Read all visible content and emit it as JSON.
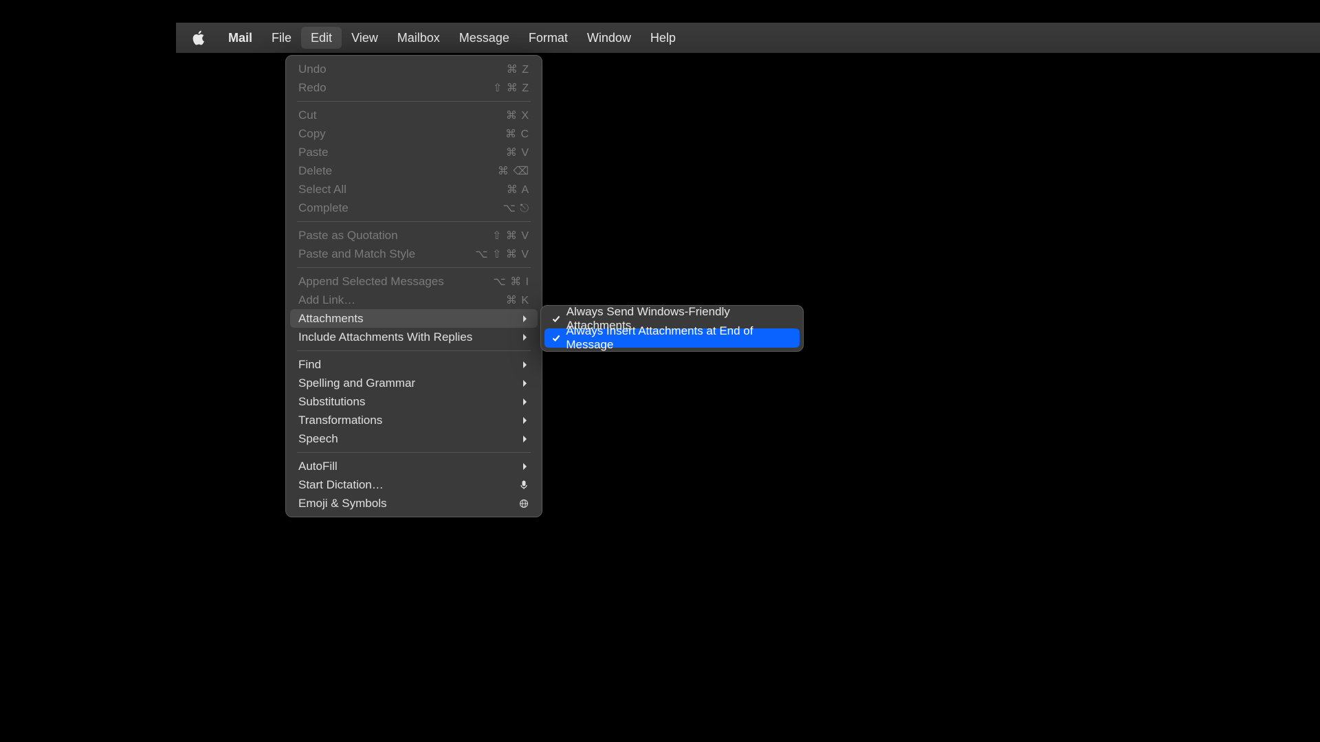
{
  "menubar": {
    "app": "Mail",
    "items": [
      "File",
      "Edit",
      "View",
      "Mailbox",
      "Message",
      "Format",
      "Window",
      "Help"
    ],
    "open_index": 1
  },
  "edit_menu": {
    "groups": [
      [
        {
          "label": "Undo",
          "shortcut": "⌘ Z",
          "disabled": true
        },
        {
          "label": "Redo",
          "shortcut": "⇧ ⌘ Z",
          "disabled": true
        }
      ],
      [
        {
          "label": "Cut",
          "shortcut": "⌘ X",
          "disabled": true
        },
        {
          "label": "Copy",
          "shortcut": "⌘ C",
          "disabled": true
        },
        {
          "label": "Paste",
          "shortcut": "⌘ V",
          "disabled": true
        },
        {
          "label": "Delete",
          "shortcut": "⌘ ⌫",
          "disabled": true
        },
        {
          "label": "Select All",
          "shortcut": "⌘ A",
          "disabled": true
        },
        {
          "label": "Complete",
          "shortcut": "⌥ ⎋",
          "disabled": true
        }
      ],
      [
        {
          "label": "Paste as Quotation",
          "shortcut": "⇧ ⌘ V",
          "disabled": true
        },
        {
          "label": "Paste and Match Style",
          "shortcut": "⌥ ⇧ ⌘ V",
          "disabled": true
        }
      ],
      [
        {
          "label": "Append Selected Messages",
          "shortcut": "⌥ ⌘ I",
          "disabled": true
        },
        {
          "label": "Add Link…",
          "shortcut": "⌘ K",
          "disabled": true
        },
        {
          "label": "Attachments",
          "submenu": true,
          "highlight": true
        },
        {
          "label": "Include Attachments With Replies",
          "submenu": true
        }
      ],
      [
        {
          "label": "Find",
          "submenu": true
        },
        {
          "label": "Spelling and Grammar",
          "submenu": true
        },
        {
          "label": "Substitutions",
          "submenu": true
        },
        {
          "label": "Transformations",
          "submenu": true
        },
        {
          "label": "Speech",
          "submenu": true
        }
      ],
      [
        {
          "label": "AutoFill",
          "submenu": true
        },
        {
          "label": "Start Dictation…",
          "icon": "mic"
        },
        {
          "label": "Emoji & Symbols",
          "icon": "globe"
        }
      ]
    ]
  },
  "attachments_submenu": {
    "items": [
      {
        "label": "Always Send Windows-Friendly Attachments",
        "checked": true,
        "selected": false
      },
      {
        "label": "Always Insert Attachments at End of Message",
        "checked": true,
        "selected": true
      }
    ]
  }
}
